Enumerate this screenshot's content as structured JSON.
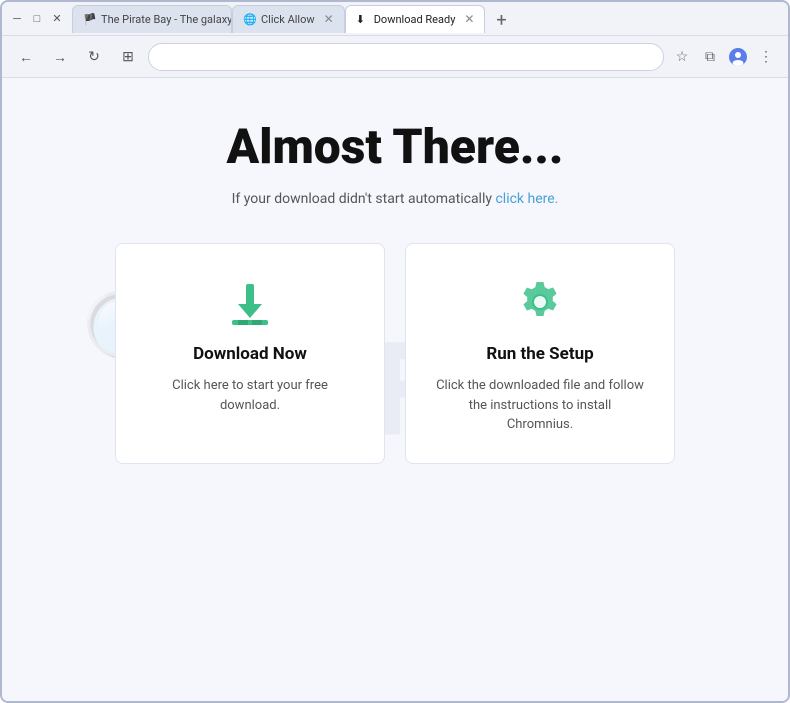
{
  "browser": {
    "tabs": [
      {
        "id": "tab1",
        "label": "The Pirate Bay - The galaxy's m...",
        "favicon": "🏴",
        "active": false
      },
      {
        "id": "tab2",
        "label": "Click Allow",
        "favicon": "🌐",
        "active": false
      },
      {
        "id": "tab3",
        "label": "Download Ready",
        "favicon": "⬇",
        "active": true
      }
    ],
    "new_tab_label": "+",
    "nav": {
      "back": "←",
      "forward": "→",
      "reload": "↻",
      "extensions": "⊞"
    },
    "address": "",
    "toolbar_icons": {
      "bookmark": "☆",
      "profile": "👤",
      "extensions_bar": "⧉",
      "menu": "⋮"
    }
  },
  "page": {
    "watermark": "OFF",
    "main_title": "Almost There...",
    "subtitle_text": "If your download didn't start automatically ",
    "subtitle_link": "click here.",
    "cards": [
      {
        "id": "download-now",
        "icon_type": "download",
        "title": "Download Now",
        "description": "Click here to start your free download."
      },
      {
        "id": "run-setup",
        "icon_type": "gear",
        "title": "Run the Setup",
        "description": "Click the downloaded file and follow the instructions to install Chromnius."
      }
    ]
  },
  "colors": {
    "accent_green": "#3dbf8a",
    "link_blue": "#4a9fd4"
  }
}
